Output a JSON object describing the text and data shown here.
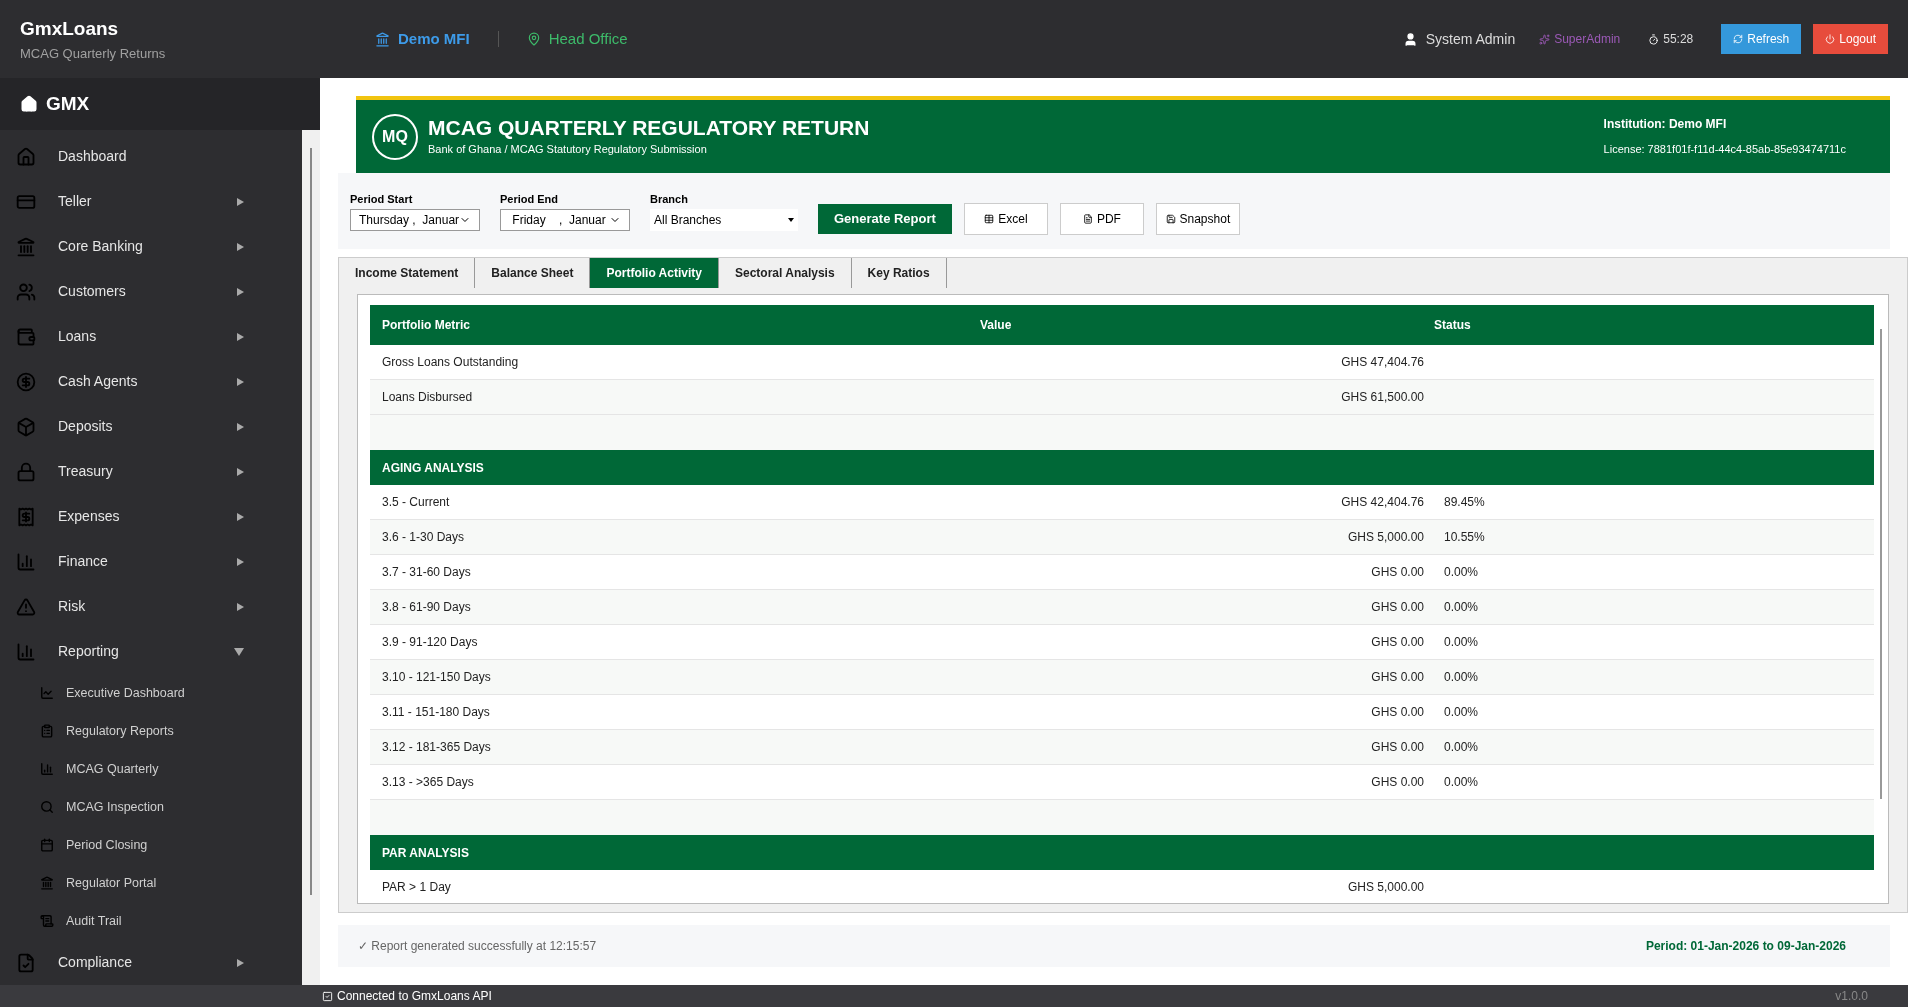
{
  "topbar": {
    "app_name": "GmxLoans",
    "app_subtitle": "MCAG Quarterly Returns",
    "institution": "Demo MFI",
    "branch": "Head Office",
    "user": "System Admin",
    "role": "SuperAdmin",
    "timer": "55:28",
    "buttons": [
      {
        "label": "Refresh",
        "kind": "info"
      },
      {
        "label": "Logout",
        "kind": "danger"
      }
    ]
  },
  "sidebar": {
    "brand": "GMX",
    "items": [
      {
        "label": "Dashboard",
        "kind": "link"
      },
      {
        "label": "Teller",
        "kind": "group",
        "expanded": false
      },
      {
        "label": "Core Banking",
        "kind": "group",
        "expanded": false
      },
      {
        "label": "Customers",
        "kind": "group",
        "expanded": false
      },
      {
        "label": "Loans",
        "kind": "group",
        "expanded": false
      },
      {
        "label": "Cash Agents",
        "kind": "group",
        "expanded": false
      },
      {
        "label": "Deposits",
        "kind": "group",
        "expanded": false
      },
      {
        "label": "Treasury",
        "kind": "group",
        "expanded": false
      },
      {
        "label": "Expenses",
        "kind": "group",
        "expanded": false
      },
      {
        "label": "Finance",
        "kind": "group",
        "expanded": false
      },
      {
        "label": "Risk",
        "kind": "group",
        "expanded": false
      },
      {
        "label": "Reporting",
        "kind": "group",
        "expanded": true,
        "children": [
          {
            "label": "Executive Dashboard"
          },
          {
            "label": "Regulatory Reports"
          },
          {
            "label": "MCAG Quarterly"
          },
          {
            "label": "MCAG Inspection"
          },
          {
            "label": "Period Closing"
          },
          {
            "label": "Regulator Portal"
          },
          {
            "label": "Audit Trail"
          }
        ]
      },
      {
        "label": "Compliance",
        "kind": "group",
        "expanded": false
      }
    ]
  },
  "report": {
    "logo": "MQ",
    "title": "MCAG QUARTERLY REGULATORY RETURN",
    "subtitle": "Bank of Ghana / MCAG Statutory Regulatory Submission",
    "institution": "Institution: Demo MFI",
    "license": "License: 7881f01f-f11d-44c4-85ab-85e93474711c"
  },
  "filters": [
    {
      "label": "Period Start",
      "value": "Thursday ,  Januar",
      "kind": "date"
    },
    {
      "label": "Period End",
      "value": " Friday    ,  Januar",
      "kind": "date"
    },
    {
      "label": "Branch",
      "value": "All Branches",
      "kind": "select"
    }
  ],
  "actions": [
    {
      "label": "Generate Report",
      "kind": "primary"
    },
    {
      "label": "Excel",
      "kind": "excel"
    },
    {
      "label": "PDF",
      "kind": "pdf"
    },
    {
      "label": "Snapshot",
      "kind": "snapshot"
    }
  ],
  "tabs": [
    {
      "label": "Income Statement",
      "selected": false
    },
    {
      "label": "Balance Sheet",
      "selected": false
    },
    {
      "label": "Portfolio Activity",
      "selected": true
    },
    {
      "label": "Sectoral Analysis",
      "selected": false
    },
    {
      "label": "Key Ratios",
      "selected": false
    }
  ],
  "table": {
    "columns": [
      "Portfolio Metric",
      "Value",
      "Status"
    ],
    "sections": [
      {
        "rows": [
          {
            "metric": "Gross Loans Outstanding",
            "value": "GHS 47,404.76"
          },
          {
            "metric": "Loans Disbursed",
            "value": "GHS 61,500.00"
          }
        ]
      },
      {
        "title": "AGING ANALYSIS",
        "rows": [
          {
            "metric": "3.5 - Current",
            "value": "GHS 42,404.76",
            "status": "89.45%"
          },
          {
            "metric": "3.6 - 1-30 Days",
            "value": "GHS 5,000.00",
            "status": "10.55%"
          },
          {
            "metric": "3.7 - 31-60 Days",
            "value": "GHS 0.00",
            "status": "0.00%"
          },
          {
            "metric": "3.8 - 61-90 Days",
            "value": "GHS 0.00",
            "status": "0.00%"
          },
          {
            "metric": "3.9 - 91-120 Days",
            "value": "GHS 0.00",
            "status": "0.00%"
          },
          {
            "metric": "3.10 - 121-150 Days",
            "value": "GHS 0.00",
            "status": "0.00%"
          },
          {
            "metric": "3.11 - 151-180 Days",
            "value": "GHS 0.00",
            "status": "0.00%"
          },
          {
            "metric": "3.12 - 181-365 Days",
            "value": "GHS 0.00",
            "status": "0.00%"
          },
          {
            "metric": "3.13 - >365 Days",
            "value": "GHS 0.00",
            "status": "0.00%"
          }
        ]
      },
      {
        "title": "PAR ANALYSIS",
        "rows": [
          {
            "metric": "PAR > 1 Day",
            "value": "GHS 5,000.00"
          }
        ]
      }
    ]
  },
  "footer": {
    "message": "✓ Report generated successfully at 12:15:57",
    "period": "Period: 01-Jan-2026 to 09-Jan-2026"
  },
  "status_bar": {
    "connection": "Connected to GmxLoans API",
    "version": "v1.0.0"
  }
}
